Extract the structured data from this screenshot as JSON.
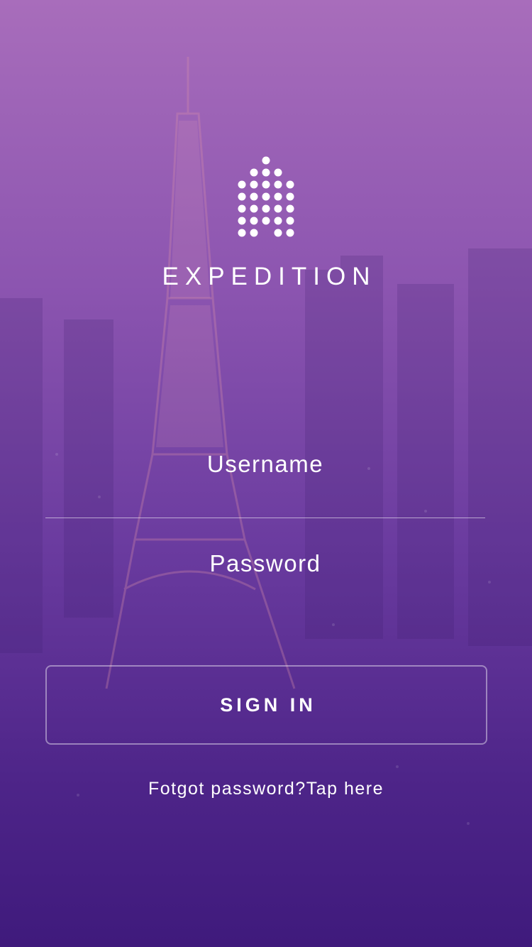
{
  "brand": {
    "name": "EXPEDITION",
    "logo_icon": "dotted-arch-icon"
  },
  "form": {
    "username_placeholder": "Username",
    "password_placeholder": "Password",
    "sign_in_label": "SIGN IN",
    "forgot_text": "Fotgot password?Tap here"
  },
  "theme": {
    "gradient_top": "#a86dbb",
    "gradient_bottom": "#3f1a7c",
    "text": "#ffffff"
  }
}
